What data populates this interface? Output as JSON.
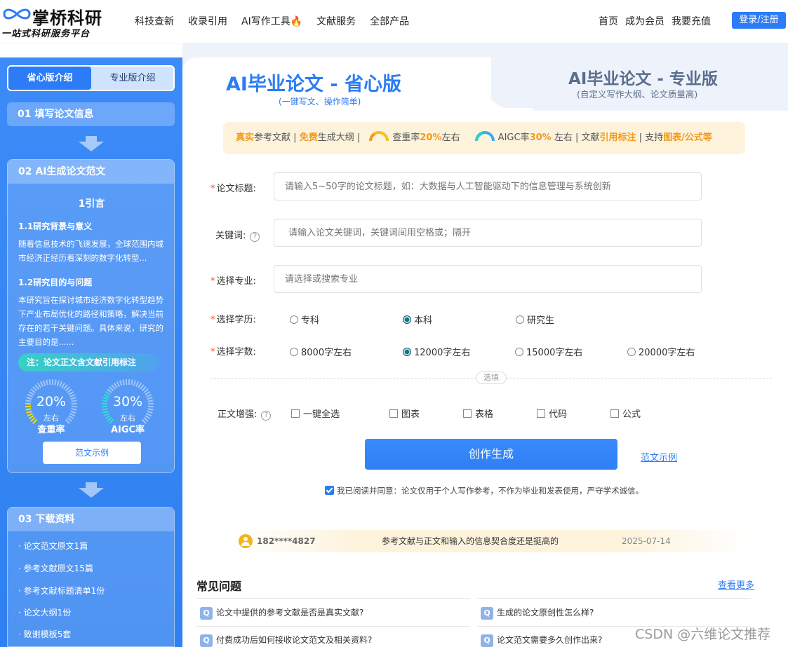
{
  "brand": {
    "name": "掌桥科研",
    "slogan": "一站式科研服务平台"
  },
  "nav": {
    "items": [
      "科技查新",
      "收录引用",
      "AI写作工具",
      "文献服务",
      "全部产品"
    ],
    "right": [
      "首页",
      "成为会员",
      "我要充值"
    ],
    "login": "登录/注册"
  },
  "sidebar": {
    "tabs": [
      "省心版介绍",
      "专业版介绍"
    ],
    "step1": "01 填写论文信息",
    "step2": "02 AI生成论文范文",
    "doc": {
      "title": "1引言",
      "sec1": "1.1研究背景与意义",
      "par1": "随着信息技术的飞速发展，全球范围内城市经济正经历着深刻的数字化转型...",
      "sec2": "1.2研究目的与问题",
      "par2": "本研究旨在探讨城市经济数字化转型趋势下产业布局优化的路径和策略，解决当前存在的若干关键问题。具体来说，研究的主要目的是......"
    },
    "note": "注：论文正文含文献引用标注",
    "gauges": [
      {
        "value": "20%",
        "sub": "左右",
        "label": "查重率",
        "color": "#f0e100",
        "level": 0.2
      },
      {
        "value": "30%",
        "sub": "左右",
        "label": "AIGC率",
        "color": "#2de0d3",
        "level": 0.3
      }
    ],
    "sample_btn": "范文示例",
    "step3": "03 下载资料",
    "downloads": [
      "· 论文范文原文1篇",
      "· 参考文献原文15篇",
      "· 参考文献标题清单1份",
      "· 论文大纲1份",
      "· 致谢模板5套"
    ]
  },
  "tabs": {
    "simple": {
      "title": "AI毕业论文 - 省心版",
      "sub": "(一键写文、操作简单)"
    },
    "pro": {
      "title": "AI毕业论文 - 专业版",
      "sub": "(自定义写作大纲、论文质量高)"
    }
  },
  "banner": {
    "p1a": "真实",
    "p1b": "参考文献",
    "sep": " | ",
    "p2a": "免费",
    "p2b": "生成大纲",
    "p3a": "查重率",
    "p3b": "20%",
    "p3c": "左右",
    "p4a": "AIGC率",
    "p4b": "30%",
    "p4c": " 左右",
    "p5a": "文献",
    "p5b": "引用标注",
    "p6a": "支持",
    "p6b": "图表/公式等"
  },
  "form": {
    "title_label": "论文标题:",
    "title_placeholder": "请输入5~50字的论文标题，如：大数据与人工智能驱动下的信息管理与系统创新",
    "keyword_label": "关键词:",
    "keyword_placeholder": "请输入论文关键词，关键词间用空格或；隔开",
    "major_label": "选择专业:",
    "major_placeholder": "请选择或搜索专业",
    "degree_label": "选择学历:",
    "degrees": [
      "专科",
      "本科",
      "研究生"
    ],
    "degree_selected": "本科",
    "words_label": "选择字数:",
    "words": [
      "8000字左右",
      "12000字左右",
      "15000字左右",
      "20000字左右"
    ],
    "words_selected": "12000字左右",
    "optional_tag": "选填",
    "enhance_label": "正文增强:",
    "enhance_options": [
      "一键全选",
      "图表",
      "表格",
      "代码",
      "公式"
    ],
    "generate": "创作生成",
    "sample_link": "范文示例",
    "agree_text": "我已阅读并同意：论文仅用于个人写作参考，不作为毕业和发表使用，严守学术诚信。"
  },
  "review": {
    "phone": "182****4827",
    "message": "参考文献与正文和输入的信息契合度还是挺高的",
    "date": "2025-07-14"
  },
  "faq": {
    "title": "常见问题",
    "more": "查看更多",
    "items": [
      "论文中提供的参考文献是否是真实文献?",
      "生成的论文原创性怎么样?",
      "付费成功后如何接收论文范文及相关资料?",
      "论文范文需要多久创作出来?"
    ]
  },
  "watermark": "CSDN @六维论文推荐"
}
